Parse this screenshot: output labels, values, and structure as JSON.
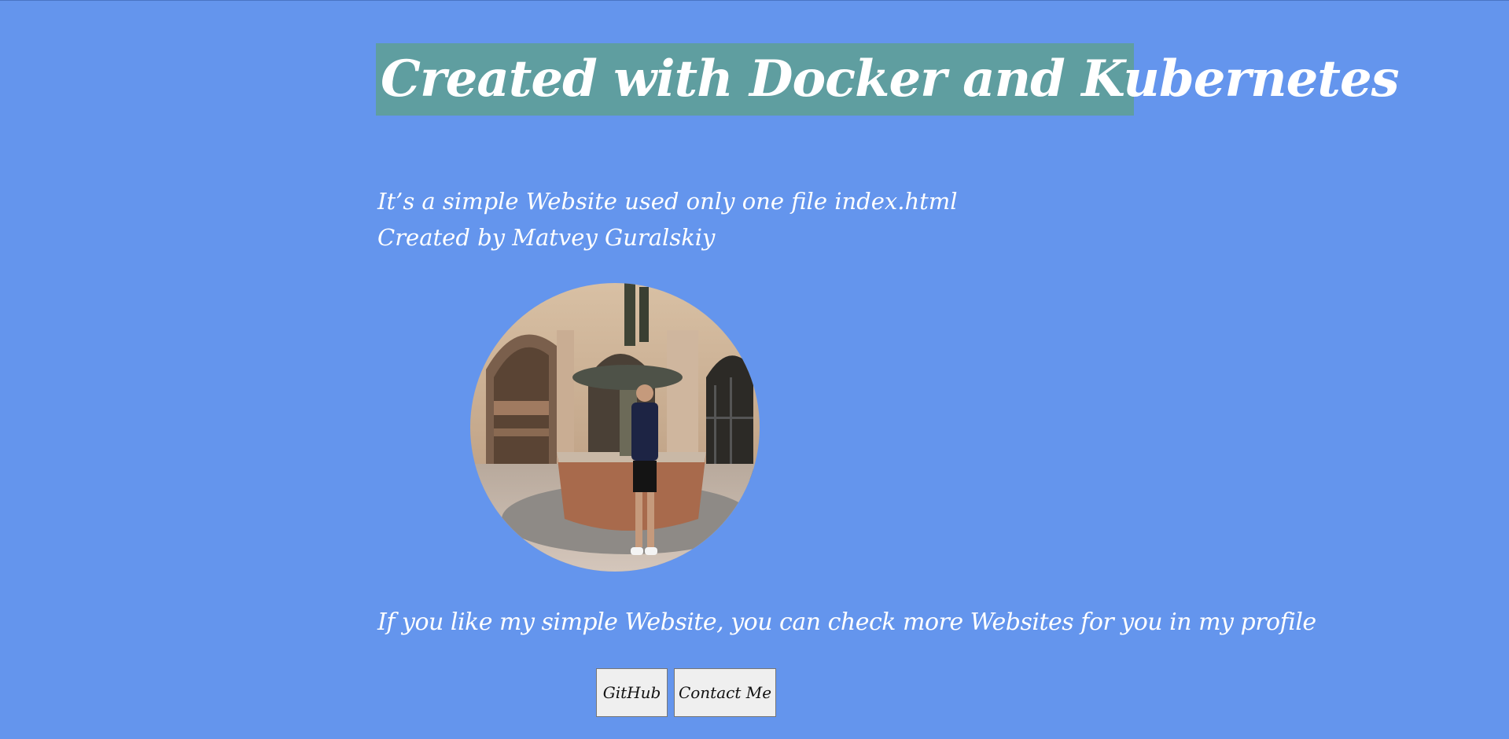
{
  "header": {
    "title": "Created with Docker and Kubernetes"
  },
  "intro": {
    "line1": "It’s a simple Website used only one file index.html",
    "line2": "Created by Matvey Guralskiy"
  },
  "profile_prompt": "If you like my simple Website, you can check more Websites for you in my profile",
  "buttons": {
    "github": "GitHub",
    "contact": "Contact Me"
  },
  "colors": {
    "background": "#6495ED",
    "title_background": "#5F9EA0",
    "text": "#ffffff",
    "button_background": "#efefef"
  }
}
